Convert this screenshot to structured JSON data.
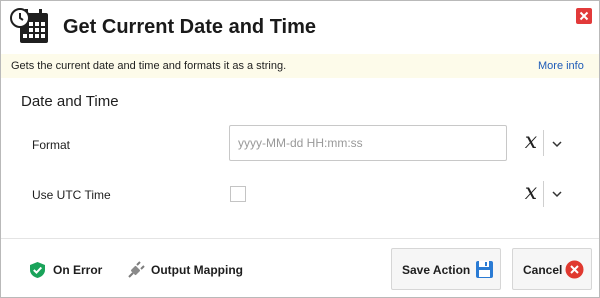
{
  "dialog": {
    "title": "Get Current Date and Time",
    "title_icon": "calendar-clock-icon",
    "close_icon": "close-icon"
  },
  "info": {
    "description": "Gets the current date and time and formats it as a string.",
    "more_info": "More info"
  },
  "section": {
    "title": "Date and Time"
  },
  "fields": {
    "format": {
      "label": "Format",
      "value": "",
      "placeholder": "yyyy-MM-dd HH:mm:ss"
    },
    "utc": {
      "label": "Use UTC Time",
      "checked": false
    }
  },
  "footer": {
    "on_error": "On Error",
    "output_mapping": "Output Mapping",
    "save": "Save Action",
    "cancel": "Cancel"
  },
  "colors": {
    "close": "#e23a3a",
    "info_bg": "#fdfbea",
    "link": "#1e5bb8",
    "shield": "#1aa35a",
    "save_icon": "#2a7bd4",
    "cancel_icon": "#e0392f"
  }
}
